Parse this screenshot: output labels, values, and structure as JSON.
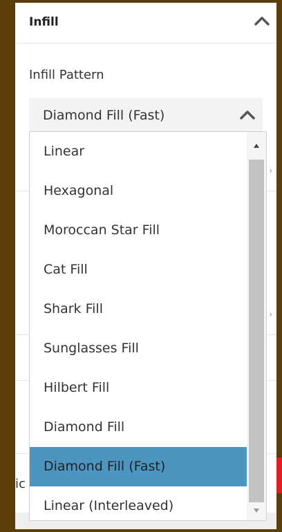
{
  "section": {
    "title": "Infill",
    "collapse_icon": "chevron-up-icon"
  },
  "field": {
    "label": "Infill Pattern",
    "selected_value": "Diamond Fill (Fast)"
  },
  "dropdown": {
    "options": [
      "Linear",
      "Hexagonal",
      "Moroccan Star Fill",
      "Cat Fill",
      "Shark Fill",
      "Sunglasses Fill",
      "Hilbert Fill",
      "Diamond Fill",
      "Diamond Fill (Fast)",
      "Linear (Interleaved)"
    ],
    "selected_index": 8,
    "selected_color": "#4d95c1"
  },
  "background": {
    "partial_text": "ic"
  },
  "colors": {
    "frame": "#5b3d08",
    "accent_red": "#e41e1e"
  }
}
